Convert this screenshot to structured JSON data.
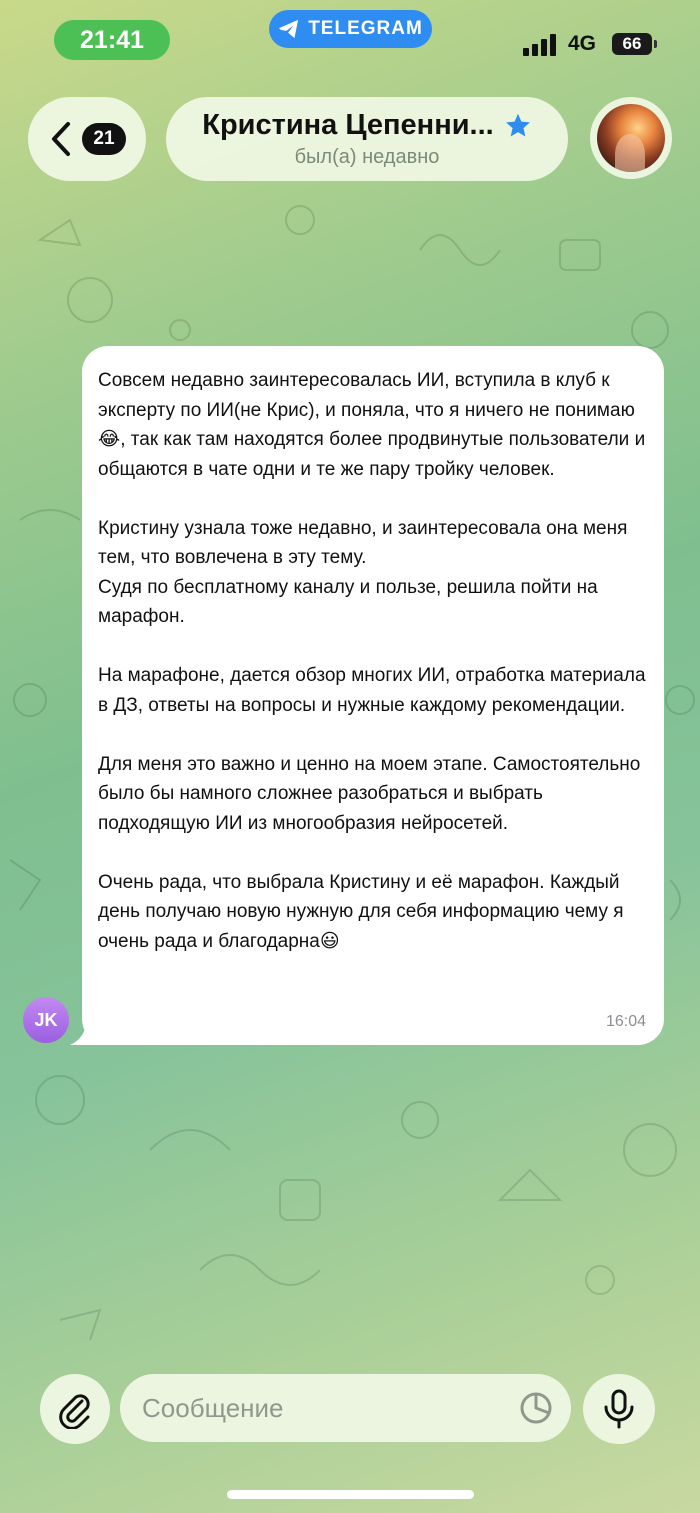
{
  "status_bar": {
    "time": "21:41",
    "app_label": "TELEGRAM",
    "network": "4G",
    "battery": "66"
  },
  "header": {
    "unread_count": "21",
    "contact_name": "Кристина Цепенни...",
    "last_seen": "был(а) недавно",
    "verified_icon": "star-badge-icon"
  },
  "message": {
    "paragraphs": [
      "Совсем недавно заинтересовалась ИИ, вступила в клуб к эксперту по ИИ(не Крис), и поняла, что я ничего не понимаю😂, так как там находятся более продвинутые пользователи и общаются в чате одни и те же пару тройку человек.",
      "Кристину узнала тоже недавно, и заинтересовала она меня тем, что вовлечена в эту тему.\nСудя по бесплатному каналу и пользе, решила пойти на марафон.",
      "На марафоне, дается обзор многих ИИ, отработка материала в ДЗ, ответы на вопросы и нужные каждому рекомендации.",
      "Для меня это важно и ценно на моем этапе. Самостоятельно было бы намного сложнее разобраться и выбрать подходящую ИИ из многообразия нейросетей.",
      "Очень рада, что выбрала Кристину и её марафон. Каждый день получаю новую нужную для себя информацию чему я очень рада и благодарна😃"
    ],
    "time": "16:04",
    "sender_initials": "JK"
  },
  "composer": {
    "placeholder": "Сообщение",
    "value": ""
  },
  "colors": {
    "time_pill": "#4cbf55",
    "telegram_pill": "#2f8df2",
    "verified_star": "#2f8df2",
    "sender_avatar": "#b07aee"
  }
}
